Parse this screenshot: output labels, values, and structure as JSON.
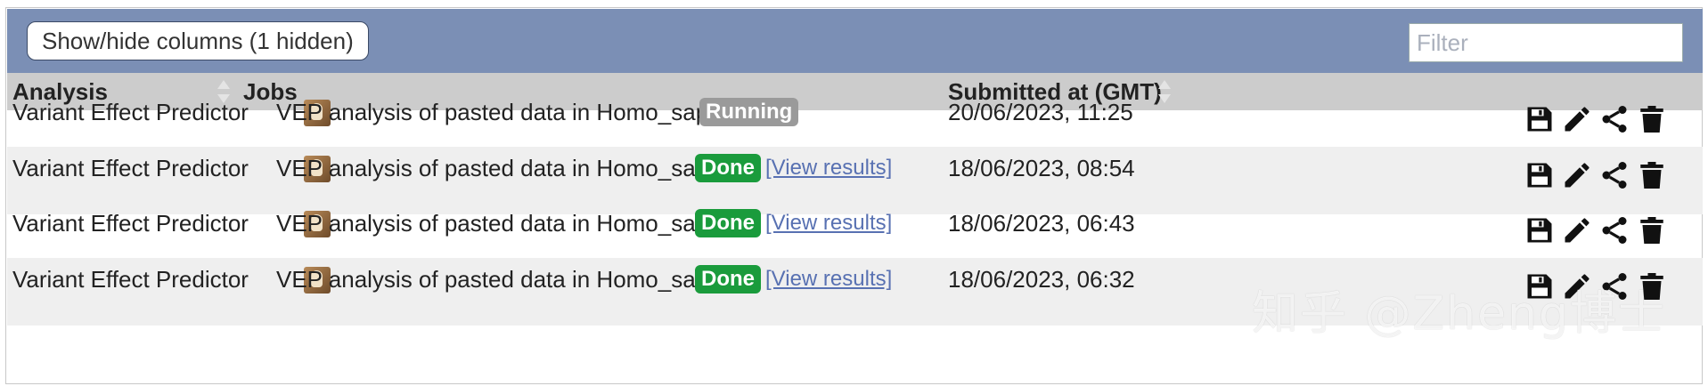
{
  "toolbar": {
    "toggle_columns_label": "Show/hide columns (1 hidden)",
    "filter_placeholder": "Filter"
  },
  "table": {
    "headers": [
      "Analysis",
      "Jobs",
      "Submitted at (GMT)"
    ],
    "rows": [
      {
        "analysis": "Variant Effect Predictor",
        "job": "VEP analysis of pasted data in Homo_sapiens",
        "status": "Running",
        "link": "",
        "submitted": "20/06/2023, 11:25"
      },
      {
        "analysis": "Variant Effect Predictor",
        "job": "VEP analysis of pasted data in Homo_sapiens",
        "status": "Done",
        "link": "[View results]",
        "submitted": "18/06/2023, 08:54"
      },
      {
        "analysis": "Variant Effect Predictor",
        "job": "VEP analysis of pasted data in Homo_sapiens",
        "status": "Done",
        "link": "[View results]",
        "submitted": "18/06/2023, 06:43"
      },
      {
        "analysis": "Variant Effect Predictor",
        "job": "VEP analysis of pasted data in Homo_sapiens",
        "status": "Done",
        "link": "[View results]",
        "submitted": "18/06/2023, 06:32"
      }
    ],
    "row_action_icons": [
      "save-icon",
      "edit-icon",
      "share-icon",
      "delete-icon"
    ]
  },
  "colors": {
    "toolbar_bg": "#7b8fb5",
    "header_bg": "#cccccc",
    "alt_row_bg": "#efefef",
    "running_badge": "#9a9a9a",
    "done_badge": "#1a9b3c",
    "link": "#5871b2"
  },
  "watermark": "知乎 @Zheng博士"
}
